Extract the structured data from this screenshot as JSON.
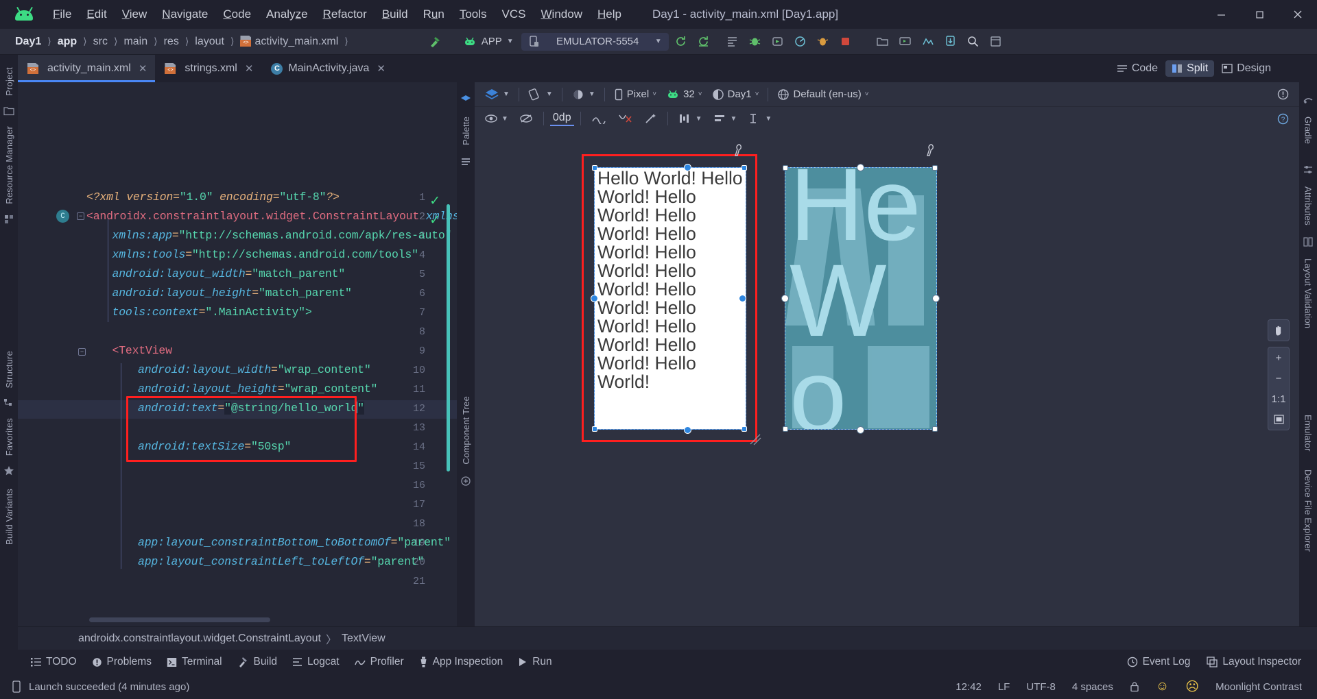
{
  "window": {
    "title": "Day1 - activity_main.xml [Day1.app]",
    "minimize": "—",
    "maximize": "□",
    "close": "✕"
  },
  "menubar": {
    "logo": "android-logo-icon",
    "items": [
      {
        "label": "File",
        "mnemonic": "F"
      },
      {
        "label": "Edit",
        "mnemonic": "E"
      },
      {
        "label": "View",
        "mnemonic": "V"
      },
      {
        "label": "Navigate",
        "mnemonic": "N"
      },
      {
        "label": "Code",
        "mnemonic": "C"
      },
      {
        "label": "Analyze",
        "mnemonic": "z"
      },
      {
        "label": "Refactor",
        "mnemonic": "R"
      },
      {
        "label": "Build",
        "mnemonic": "B"
      },
      {
        "label": "Run",
        "mnemonic": "u"
      },
      {
        "label": "Tools",
        "mnemonic": "T"
      },
      {
        "label": "VCS",
        "mnemonic": ""
      },
      {
        "label": "Window",
        "mnemonic": "W"
      },
      {
        "label": "Help",
        "mnemonic": "H"
      }
    ]
  },
  "breadcrumbs": {
    "items": [
      "Day1",
      "app",
      "src",
      "main",
      "res",
      "layout",
      "activity_main.xml"
    ],
    "separator": "〉"
  },
  "toolbar": {
    "build_label": "build-hammer-icon",
    "run_config_label": "APP",
    "device_label": "EMULATOR-5554",
    "icons": [
      "sync-gradle-icon",
      "avd-manager-icon",
      "sdk-manager-icon",
      "run-icon",
      "debug-icon",
      "run-coverage-icon",
      "profile-icon",
      "apply-changes-icon",
      "stop-icon",
      "project-structure-icon",
      "avd-icon",
      "sdk-icon",
      "device-manager-icon",
      "search-icon",
      "layout-icon"
    ]
  },
  "editor_tabs": [
    {
      "label": "activity_main.xml",
      "icon": "xml-file-icon",
      "active": true,
      "close": "✕"
    },
    {
      "label": "strings.xml",
      "icon": "xml-file-icon",
      "active": false,
      "close": "✕"
    },
    {
      "label": "MainActivity.java",
      "icon": "java-class-icon",
      "active": false,
      "close": "✕"
    }
  ],
  "view_modes": {
    "code": "Code",
    "split": "Split",
    "design": "Design",
    "selected": "Split"
  },
  "left_rail": {
    "items": [
      "Project",
      "Resource Manager",
      "Structure",
      "Favorites",
      "Build Variants"
    ]
  },
  "right_rail": {
    "items": [
      "Gradle",
      "Attributes",
      "Layout Validation",
      "Emulator",
      "Device File Explorer"
    ]
  },
  "middle_rail": {
    "items": [
      "Palette",
      "Component Tree"
    ]
  },
  "code": {
    "language": "xml",
    "lines": [
      {
        "n": 1,
        "indent": 0,
        "tokens": [
          {
            "t": "<?xml ",
            "c": "k-decl"
          },
          {
            "t": "version",
            "c": "k-decl"
          },
          {
            "t": "=",
            "c": "k-eq"
          },
          {
            "t": "\"1.0\"",
            "c": "k-val"
          },
          {
            "t": " ",
            "c": "k-punc"
          },
          {
            "t": "encoding",
            "c": "k-decl"
          },
          {
            "t": "=",
            "c": "k-eq"
          },
          {
            "t": "\"utf-8\"",
            "c": "k-val"
          },
          {
            "t": "?>",
            "c": "k-decl"
          }
        ]
      },
      {
        "n": 2,
        "indent": 0,
        "tokens": [
          {
            "t": "<androidx.constraintlayout.widget.ConstraintLayout",
            "c": "k-tag"
          },
          {
            "t": " ",
            "c": "k-punc"
          },
          {
            "t": "xmlns:and",
            "c": "k-attr"
          }
        ]
      },
      {
        "n": 3,
        "indent": 1,
        "tokens": [
          {
            "t": "xmlns:app",
            "c": "k-attr"
          },
          {
            "t": "=",
            "c": "k-eq"
          },
          {
            "t": "\"http://schemas.android.com/apk/res-auto\"",
            "c": "k-val"
          }
        ]
      },
      {
        "n": 4,
        "indent": 1,
        "tokens": [
          {
            "t": "xmlns:tools",
            "c": "k-attr"
          },
          {
            "t": "=",
            "c": "k-eq"
          },
          {
            "t": "\"http://schemas.android.com/tools\"",
            "c": "k-val"
          }
        ]
      },
      {
        "n": 5,
        "indent": 1,
        "tokens": [
          {
            "t": "android:layout_width",
            "c": "k-attr"
          },
          {
            "t": "=",
            "c": "k-eq"
          },
          {
            "t": "\"match_parent\"",
            "c": "k-val"
          }
        ]
      },
      {
        "n": 6,
        "indent": 1,
        "tokens": [
          {
            "t": "android:layout_height",
            "c": "k-attr"
          },
          {
            "t": "=",
            "c": "k-eq"
          },
          {
            "t": "\"match_parent\"",
            "c": "k-val"
          }
        ]
      },
      {
        "n": 7,
        "indent": 1,
        "tokens": [
          {
            "t": "tools:context",
            "c": "k-attr"
          },
          {
            "t": "=",
            "c": "k-eq"
          },
          {
            "t": "\".MainActivity\">",
            "c": "k-val"
          }
        ]
      },
      {
        "n": 8,
        "indent": 0,
        "tokens": []
      },
      {
        "n": 9,
        "indent": 1,
        "tokens": [
          {
            "t": "<TextView",
            "c": "k-tag"
          }
        ]
      },
      {
        "n": 10,
        "indent": 2,
        "tokens": [
          {
            "t": "android:layout_width",
            "c": "k-attr"
          },
          {
            "t": "=",
            "c": "k-eq"
          },
          {
            "t": "\"wrap_content\"",
            "c": "k-val"
          }
        ]
      },
      {
        "n": 11,
        "indent": 2,
        "tokens": [
          {
            "t": "android:layout_height",
            "c": "k-attr"
          },
          {
            "t": "=",
            "c": "k-eq"
          },
          {
            "t": "\"wrap_content\"",
            "c": "k-val"
          }
        ]
      },
      {
        "n": 12,
        "indent": 2,
        "current": true,
        "tokens": [
          {
            "t": "android:text",
            "c": "k-attr"
          },
          {
            "t": "=",
            "c": "k-eq"
          },
          {
            "t": "\"",
            "c": "k-val sel"
          },
          {
            "t": "@string/hello_world",
            "c": "k-val"
          },
          {
            "t": "│",
            "c": "caret"
          },
          {
            "t": "\"",
            "c": "k-val sel"
          }
        ]
      },
      {
        "n": 13,
        "indent": 0,
        "tokens": []
      },
      {
        "n": 14,
        "indent": 2,
        "tokens": [
          {
            "t": "android:textSize",
            "c": "k-attr"
          },
          {
            "t": "=",
            "c": "k-eq"
          },
          {
            "t": "\"50sp\"",
            "c": "k-val"
          }
        ]
      },
      {
        "n": 15,
        "indent": 0,
        "tokens": []
      },
      {
        "n": 16,
        "indent": 0,
        "tokens": []
      },
      {
        "n": 17,
        "indent": 0,
        "tokens": []
      },
      {
        "n": 18,
        "indent": 0,
        "tokens": []
      },
      {
        "n": 19,
        "indent": 2,
        "tokens": [
          {
            "t": "app:layout_constraintBottom_toBottomOf",
            "c": "k-attr"
          },
          {
            "t": "=",
            "c": "k-eq"
          },
          {
            "t": "\"parent\"",
            "c": "k-val"
          }
        ]
      },
      {
        "n": 20,
        "indent": 2,
        "tokens": [
          {
            "t": "app:layout_constraintLeft_toLeftOf",
            "c": "k-attr"
          },
          {
            "t": "=",
            "c": "k-eq"
          },
          {
            "t": "\"parent\"",
            "c": "k-val"
          }
        ]
      },
      {
        "n": 21,
        "indent": 0,
        "tokens": []
      }
    ],
    "class_badge": "C",
    "ok_check": "✓"
  },
  "design_toolbar": {
    "design_surface_label": "design-surface-icon",
    "orientation_label": "orientation-icon",
    "theme_label": "theme-icon",
    "device": "Pixel",
    "api": "32",
    "theme": "Day1",
    "locale": "Default (en-us)",
    "warning_icon": "warning-badge-icon",
    "help_icon": "help-icon"
  },
  "design_toolbar2": {
    "visibility": "eye-icon",
    "blueprint": "blueprint-toggle-icon",
    "margin_value": "0dp",
    "chain_icon": "chain-icon",
    "clear_constraints_icon": "clear-constraints-icon",
    "infer_constraints_icon": "magic-wand-icon",
    "pack_icon": "pack-icon",
    "align_icon": "align-icon",
    "guidelines_icon": "guidelines-icon"
  },
  "preview": {
    "device_a_text": "Hello World! Hello World! Hello World! Hello World! Hello World! Hello World! Hello World! Hello World! Hello World! Hello World! Hello World! Hello World!",
    "device_b_text": "He Wo",
    "wrench_icon": "wrench-icon"
  },
  "zoom_controls": {
    "pan": "pan-hand-icon",
    "zoom_in": "+",
    "zoom_out": "−",
    "actual_size": "1:1",
    "fit": "fit-screen-icon"
  },
  "component_breadcrumb": {
    "root": "androidx.constraintlayout.widget.ConstraintLayout",
    "separator": "〉",
    "child": "TextView"
  },
  "bottom_tools": [
    {
      "label": "TODO",
      "icon": "todo-list-icon"
    },
    {
      "label": "Problems",
      "icon": "problems-icon"
    },
    {
      "label": "Terminal",
      "icon": "terminal-icon"
    },
    {
      "label": "Build",
      "icon": "build-hammer-icon"
    },
    {
      "label": "Logcat",
      "icon": "logcat-icon"
    },
    {
      "label": "Profiler",
      "icon": "profiler-icon"
    },
    {
      "label": "App Inspection",
      "icon": "app-inspection-icon"
    },
    {
      "label": "Run",
      "icon": "run-play-icon"
    }
  ],
  "bottom_tools_right": [
    {
      "label": "Event Log",
      "icon": "event-log-icon"
    },
    {
      "label": "Layout Inspector",
      "icon": "layout-inspector-icon"
    }
  ],
  "statusbar": {
    "message": "Launch succeeded (4 minutes ago)",
    "message_icon": "device-icon",
    "time": "12:42",
    "line_sep": "LF",
    "encoding": "UTF-8",
    "indent": "4 spaces",
    "theme": "Moonlight Contrast",
    "lock_icon": "lock-icon",
    "happy_icon": "☺",
    "sad_icon": "☹"
  },
  "colors": {
    "accent": "#4a88f7",
    "bg": "#20212e",
    "editor_bg": "#252735",
    "panel_bg": "#2e3140",
    "highlight_red": "#ff1f1f",
    "android_green": "#3ddc84",
    "preview_blue": "#4d8e9e"
  }
}
